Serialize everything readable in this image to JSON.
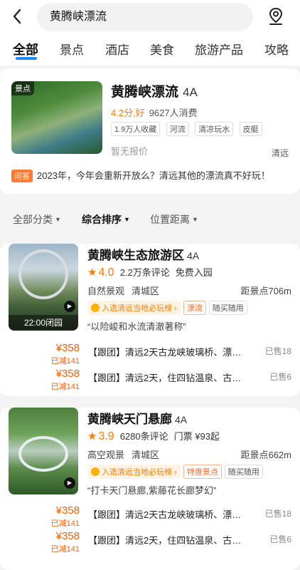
{
  "header": {
    "back_icon": "back-arrow-icon",
    "search_value": "黄腾峡漂流",
    "location_icon": "location-pin-icon"
  },
  "tabs": [
    {
      "label": "全部",
      "active": true
    },
    {
      "label": "景点"
    },
    {
      "label": "酒店"
    },
    {
      "label": "美食"
    },
    {
      "label": "旅游产品"
    },
    {
      "label": "攻略"
    }
  ],
  "top_card": {
    "image_tag": "景点",
    "title": "黄腾峡漂流",
    "grade": "4A",
    "score": "4.2分,好",
    "consume": "9627人消费",
    "chips": [
      "1.9万人收藏",
      "河流",
      "清凉玩水",
      "皮艇"
    ],
    "price_note": "暂无报价",
    "city": "清远",
    "qa_tag": "问答",
    "qa_text": "2023年，今年会重新开放么？清远其他的漂流真不好玩！"
  },
  "filters": {
    "category": "全部分类",
    "sort": "综合排序",
    "distance": "位置距离"
  },
  "items": [
    {
      "title": "黄腾峡生态旅游区",
      "grade": "4A",
      "rating": "4.0",
      "reviews": "2.2万条评论",
      "ticket": "免费入园",
      "type": "自然景观",
      "city": "清城区",
      "distance": "距景点706m",
      "rank_tag": "入选清远当地必玩榜",
      "cat_tag": "漂流",
      "extra_tag": "随买随用",
      "quote": "“以险峻和水流清澈著称”",
      "image_footer": "22:00闭园",
      "deals": [
        {
          "price": "¥358",
          "cut": "已减141",
          "text": "【跟团】清远2天古龙峡玻璃桥、漂…",
          "sold": "已售18"
        },
        {
          "price": "¥358",
          "cut": "已减141",
          "text": "【跟团】清远2天，住四钻温泉、古…",
          "sold": "已售6"
        }
      ]
    },
    {
      "title": "黄腾峡天门悬廊",
      "grade": "4A",
      "rating": "3.9",
      "reviews": "6280条评论",
      "ticket": "门票 ¥93起",
      "type": "高空观景",
      "city": "清城区",
      "distance": "距景点662m",
      "rank_tag": "入选清远当地必玩榜",
      "cat_tag": "特惠景点",
      "extra_tag": "随买随用",
      "quote": "“打卡天门悬廊,紫藤花长廊梦幻”",
      "deals": [
        {
          "price": "¥358",
          "cut": "已减141",
          "text": "【跟团】清远2天古龙峡玻璃桥、漂…",
          "sold": "已售18"
        },
        {
          "price": "¥358",
          "cut": "已减141",
          "text": "【跟团】清远2天，住四钻温泉、古…",
          "sold": "已售6"
        }
      ]
    }
  ],
  "colors": {
    "accent": "#ff7a00",
    "price": "#ff5a00",
    "tab_underline": "#1f8cff"
  }
}
